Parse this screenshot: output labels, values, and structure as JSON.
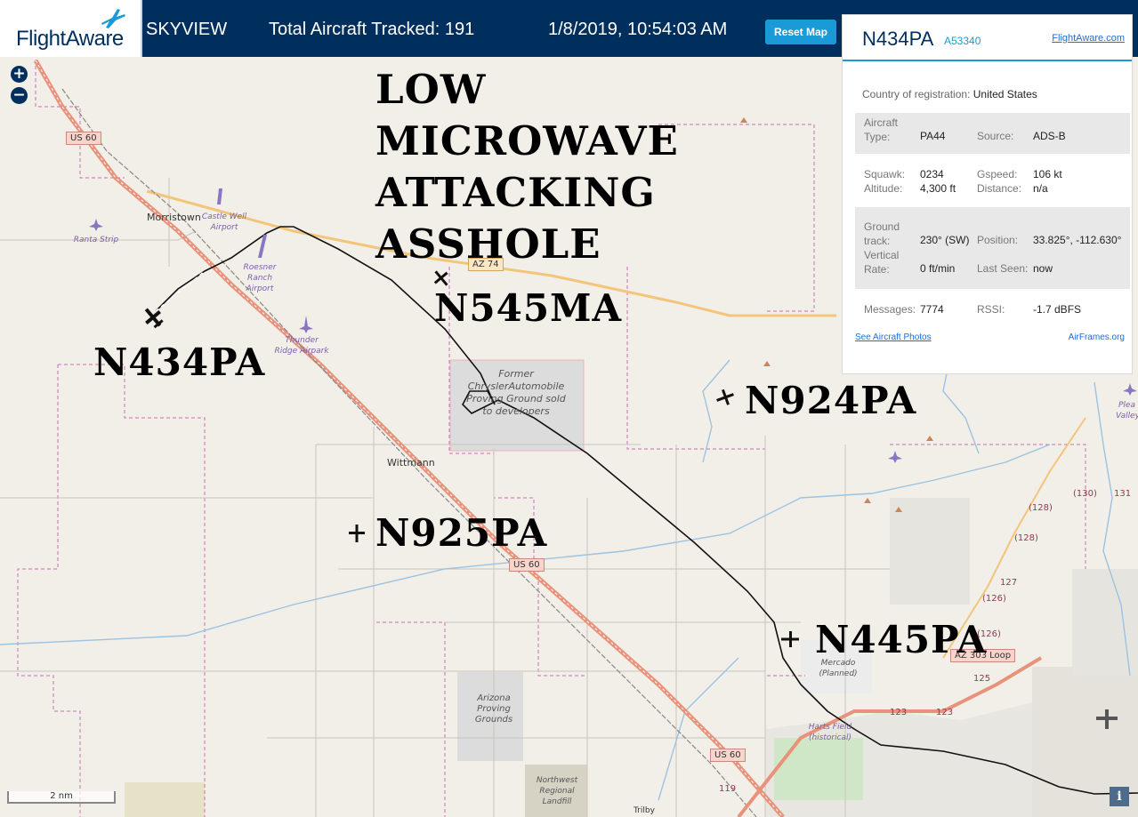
{
  "header": {
    "logo_text": "FlightAware",
    "app_name": "SKYVIEW",
    "aircraft_tracked": "Total Aircraft Tracked: 191",
    "datetime": "1/8/2019, 10:54:03 AM",
    "reset_label": "Reset Map"
  },
  "zoom": {
    "in_label": "+",
    "out_label": "−"
  },
  "panel": {
    "tail": "N434PA",
    "hex": "A53340",
    "fa_link": "FlightAware.com",
    "country_label": "Country of registration:",
    "country_value": "United States",
    "aircraft_type_label": "Aircraft Type:",
    "aircraft_type_value": "PA44",
    "source_label": "Source:",
    "source_value": "ADS-B",
    "squawk_label": "Squawk:",
    "squawk_value": "0234",
    "gspeed_label": "Gspeed:",
    "gspeed_value": "106 kt",
    "altitude_label": "Altitude:",
    "altitude_value": "4,300 ft",
    "distance_label": "Distance:",
    "distance_value": "n/a",
    "track_label": "Ground track:",
    "track_value": "230° (SW)",
    "position_label": "Position:",
    "position_value": "33.825°, -112.630°",
    "vrate_label": "Vertical Rate:",
    "vrate_value": "0 ft/min",
    "lastseen_label": "Last Seen:",
    "lastseen_value": "now",
    "messages_label": "Messages:",
    "messages_value": "7774",
    "rssi_label": "RSSI:",
    "rssi_value": "-1.7 dBFS",
    "photos_link": "See Aircraft Photos",
    "airframes_link": "AirFrames.org"
  },
  "map_labels": {
    "morristown": "Morristown",
    "wittmann": "Wittmann",
    "castle_well": "Castle Well Airport",
    "ranta": "Ranta Strip",
    "roesner": "Roesner Ranch Airport",
    "thunder": "Thunder Ridge Airpark",
    "chrysler": "Former ChryslerAutomobile Proving Ground sold to developers",
    "arizona_pg": "Arizona Proving Grounds",
    "nw_landfill": "Northwest Regional Landfill",
    "mercado": "Mercado (Planned)",
    "harts": "Harts Field (historical)",
    "pleasant_valley": "Plea Valley",
    "trilby": "Trilby",
    "us60_a": "US 60",
    "us60_b": "US 60",
    "us60_c": "US 60",
    "az74": "AZ 74",
    "az303": "AZ 303 Loop",
    "r130": "(130)",
    "r131": "131",
    "r128a": "(128)",
    "r128b": "(128)",
    "r127": "127",
    "r126a": "(126)",
    "r126b": "(126)",
    "r125": "125",
    "r123a": "123",
    "r123b": "123",
    "r119": "119"
  },
  "annotations": {
    "slogan_1": "LOW",
    "slogan_2": "MICROWAVE",
    "slogan_3": "ATTACKING",
    "slogan_4": "ASSHOLE",
    "tag_n545ma": "N545MA",
    "tag_n434pa": "N434PA",
    "tag_n924pa": "N924PA",
    "tag_n925pa": "N925PA",
    "tag_n445pa": "N445PA"
  },
  "scale_label": "2 nm",
  "info_label": "i",
  "colors": {
    "header_bg": "#002f5d",
    "accent": "#1a9bd7",
    "map_bg": "#f2efe9",
    "highway": "#e8927c",
    "boundary": "#c86fb4"
  }
}
